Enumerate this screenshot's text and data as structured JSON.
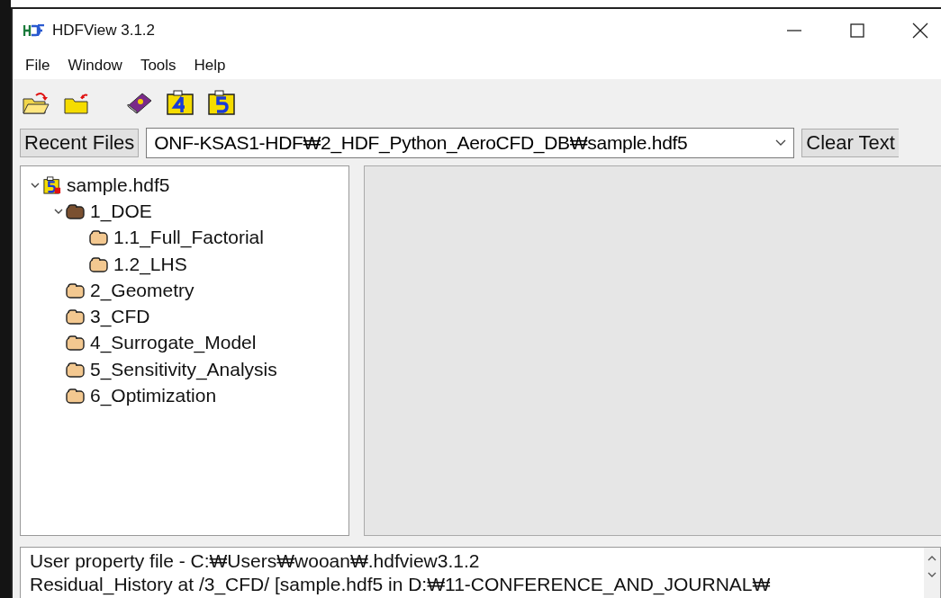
{
  "window": {
    "title": "HDFView 3.1.2"
  },
  "menu": [
    "File",
    "Window",
    "Tools",
    "Help"
  ],
  "recent_files_button": "Recent Files",
  "file_path": {
    "value": "ONF-KSAS1-HDF₩2_HDF_Python_AeroCFD_DB₩sample.hdf5"
  },
  "clear_text_button": "Clear Text",
  "tree": [
    {
      "label": "sample.hdf5",
      "kind": "file",
      "expanded": true,
      "children": [
        {
          "label": "1_DOE",
          "kind": "group",
          "expanded": true,
          "children": [
            {
              "label": "1.1_Full_Factorial",
              "kind": "group"
            },
            {
              "label": "1.2_LHS",
              "kind": "group"
            }
          ]
        },
        {
          "label": "2_Geometry",
          "kind": "group"
        },
        {
          "label": "3_CFD",
          "kind": "group"
        },
        {
          "label": "4_Surrogate_Model",
          "kind": "group"
        },
        {
          "label": "5_Sensitivity_Analysis",
          "kind": "group"
        },
        {
          "label": "6_Optimization",
          "kind": "group"
        }
      ]
    }
  ],
  "status_lines": [
    "User property file - C:₩Users₩wooan₩.hdfview3.1.2",
    "Residual_History at /3_CFD/ [sample.hdf5 in D:₩11-CONFERENCE_AND_JOURNAL₩"
  ]
}
